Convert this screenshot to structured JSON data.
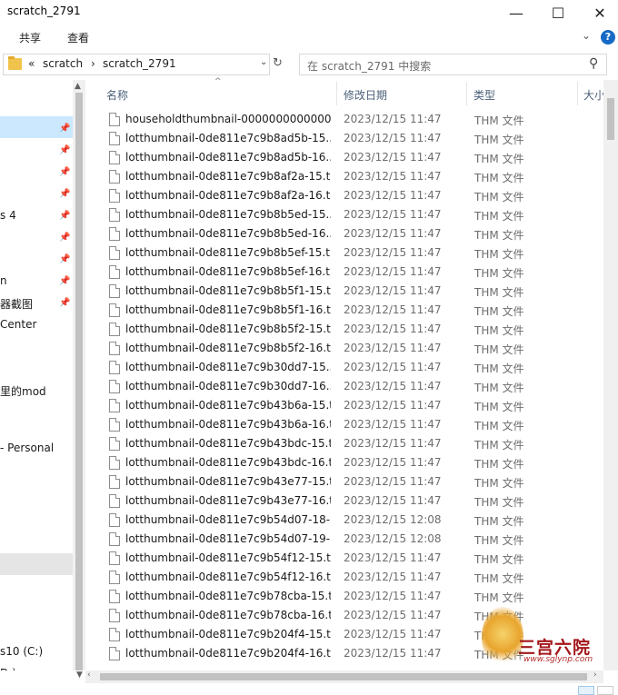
{
  "window": {
    "title": "scratch_2791",
    "minimize_glyph": "—",
    "maximize_glyph": "☐",
    "close_glyph": "✕"
  },
  "ribbon": {
    "tabs": [
      "共享",
      "查看"
    ],
    "expand_glyph": "⌄",
    "help_glyph": "?"
  },
  "address": {
    "overflow": "«",
    "crumbs": [
      "scratch",
      "scratch_2791"
    ],
    "separator": "›",
    "dropdown_glyph": "⌄",
    "refresh_glyph": "↻"
  },
  "search": {
    "placeholder": "在 scratch_2791 中搜索",
    "icon_glyph": "⚲"
  },
  "nav": {
    "items": [
      {
        "label": "s 4"
      },
      {
        "label": "n"
      },
      {
        "label": "器截图"
      },
      {
        "label": "Center"
      },
      {
        "label": "里的mod"
      },
      {
        "label": "- Personal"
      },
      {
        "label": "s10 (C:)"
      },
      {
        "label": "D:)"
      }
    ],
    "pin_glyph": "📌"
  },
  "columns": {
    "name": "名称",
    "date": "修改日期",
    "type": "类型",
    "size": "大小",
    "sort_glyph": "^"
  },
  "files": [
    {
      "name": "householdthumbnail-0000000000000...",
      "date": "2023/12/15 11:47",
      "type": "THM 文件"
    },
    {
      "name": "lotthumbnail-0de811e7c9b8ad5b-15....",
      "date": "2023/12/15 11:47",
      "type": "THM 文件"
    },
    {
      "name": "lotthumbnail-0de811e7c9b8ad5b-16....",
      "date": "2023/12/15 11:47",
      "type": "THM 文件"
    },
    {
      "name": "lotthumbnail-0de811e7c9b8af2a-15.t...",
      "date": "2023/12/15 11:47",
      "type": "THM 文件"
    },
    {
      "name": "lotthumbnail-0de811e7c9b8af2a-16.t...",
      "date": "2023/12/15 11:47",
      "type": "THM 文件"
    },
    {
      "name": "lotthumbnail-0de811e7c9b8b5ed-15....",
      "date": "2023/12/15 11:47",
      "type": "THM 文件"
    },
    {
      "name": "lotthumbnail-0de811e7c9b8b5ed-16....",
      "date": "2023/12/15 11:47",
      "type": "THM 文件"
    },
    {
      "name": "lotthumbnail-0de811e7c9b8b5ef-15.t...",
      "date": "2023/12/15 11:47",
      "type": "THM 文件"
    },
    {
      "name": "lotthumbnail-0de811e7c9b8b5ef-16.t...",
      "date": "2023/12/15 11:47",
      "type": "THM 文件"
    },
    {
      "name": "lotthumbnail-0de811e7c9b8b5f1-15.t...",
      "date": "2023/12/15 11:47",
      "type": "THM 文件"
    },
    {
      "name": "lotthumbnail-0de811e7c9b8b5f1-16.t...",
      "date": "2023/12/15 11:47",
      "type": "THM 文件"
    },
    {
      "name": "lotthumbnail-0de811e7c9b8b5f2-15.t...",
      "date": "2023/12/15 11:47",
      "type": "THM 文件"
    },
    {
      "name": "lotthumbnail-0de811e7c9b8b5f2-16.t...",
      "date": "2023/12/15 11:47",
      "type": "THM 文件"
    },
    {
      "name": "lotthumbnail-0de811e7c9b30dd7-15....",
      "date": "2023/12/15 11:47",
      "type": "THM 文件"
    },
    {
      "name": "lotthumbnail-0de811e7c9b30dd7-16....",
      "date": "2023/12/15 11:47",
      "type": "THM 文件"
    },
    {
      "name": "lotthumbnail-0de811e7c9b43b6a-15.t...",
      "date": "2023/12/15 11:47",
      "type": "THM 文件"
    },
    {
      "name": "lotthumbnail-0de811e7c9b43b6a-16.t...",
      "date": "2023/12/15 11:47",
      "type": "THM 文件"
    },
    {
      "name": "lotthumbnail-0de811e7c9b43bdc-15.t...",
      "date": "2023/12/15 11:47",
      "type": "THM 文件"
    },
    {
      "name": "lotthumbnail-0de811e7c9b43bdc-16.t...",
      "date": "2023/12/15 11:47",
      "type": "THM 文件"
    },
    {
      "name": "lotthumbnail-0de811e7c9b43e77-15.t...",
      "date": "2023/12/15 11:47",
      "type": "THM 文件"
    },
    {
      "name": "lotthumbnail-0de811e7c9b43e77-16.t...",
      "date": "2023/12/15 11:47",
      "type": "THM 文件"
    },
    {
      "name": "lotthumbnail-0de811e7c9b54d07-18-...",
      "date": "2023/12/15 12:08",
      "type": "THM 文件"
    },
    {
      "name": "lotthumbnail-0de811e7c9b54d07-19-...",
      "date": "2023/12/15 12:08",
      "type": "THM 文件"
    },
    {
      "name": "lotthumbnail-0de811e7c9b54f12-15.t...",
      "date": "2023/12/15 11:47",
      "type": "THM 文件"
    },
    {
      "name": "lotthumbnail-0de811e7c9b54f12-16.t...",
      "date": "2023/12/15 11:47",
      "type": "THM 文件"
    },
    {
      "name": "lotthumbnail-0de811e7c9b78cba-15.t...",
      "date": "2023/12/15 11:47",
      "type": "THM 文件"
    },
    {
      "name": "lotthumbnail-0de811e7c9b78cba-16.t...",
      "date": "2023/12/15 11:47",
      "type": "THM 文件"
    },
    {
      "name": "lotthumbnail-0de811e7c9b204f4-15.t...",
      "date": "2023/12/15 11:47",
      "type": "THM 文件"
    },
    {
      "name": "lotthumbnail-0de811e7c9b204f4-16.t...",
      "date": "2023/12/15 11:47",
      "type": "THM 文件"
    }
  ],
  "scroll": {
    "up_glyph": "▲",
    "down_glyph": "▼",
    "left_glyph": "‹",
    "right_glyph": "›"
  },
  "watermark": {
    "text": "三宫六院",
    "url": "www.sglynp.com"
  },
  "colors": {
    "accent": "#1769c6",
    "selection": "#cce8ff",
    "header_text": "#4c607a",
    "watermark": "#a3171b"
  }
}
